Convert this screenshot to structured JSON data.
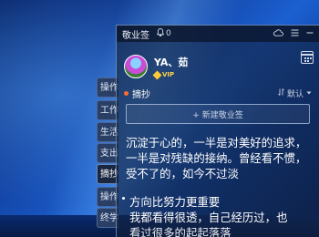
{
  "side_tabs": [
    "操作",
    "工作",
    "生活",
    "支出",
    "摘抄",
    "操作",
    "终学"
  ],
  "panel": {
    "title": "敬业签",
    "notification_count": "0",
    "username": "YA、茹",
    "vip_label": "VIP",
    "section_label": "摘抄",
    "sort_label": "默认",
    "add_button_label": "+ 新建敬业签",
    "notes": [
      {
        "text": "沉淀于心的，一半是对美好的追求，一半是对残缺的接纳。曾经看不惯，受不了的，如今不过淡"
      },
      {
        "title": "方向比努力更重要",
        "line": "我都看得很透，自己经历过，也",
        "line_partial": "看过很多的起起落落"
      }
    ]
  },
  "colors": {
    "accent_dot": "#ff6a2a",
    "vip": "#ffcc33",
    "active_tab": "#1a2740"
  }
}
